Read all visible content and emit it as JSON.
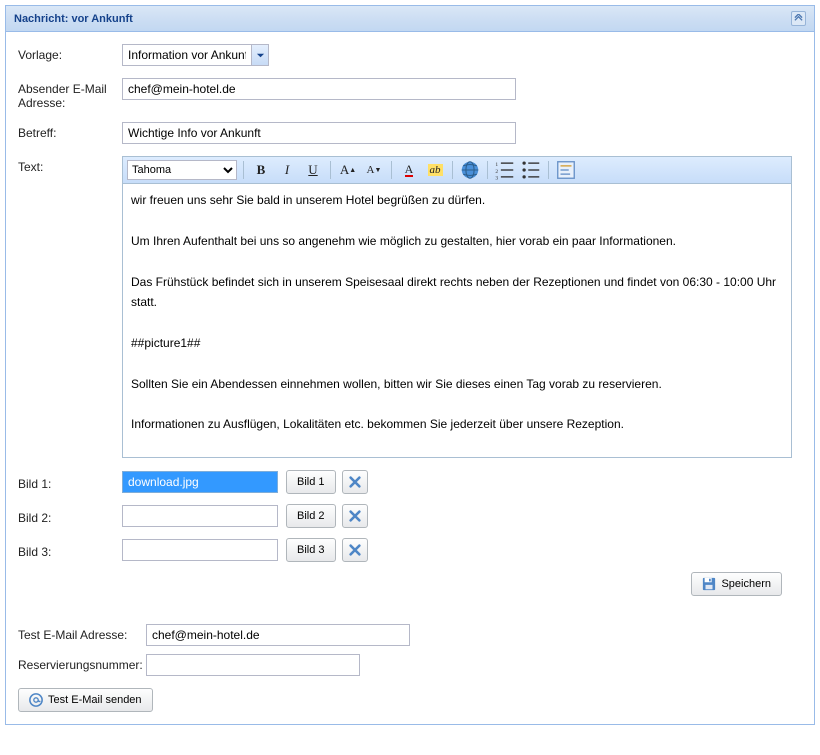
{
  "header": {
    "title": "Nachricht: vor Ankunft"
  },
  "labels": {
    "vorlage": "Vorlage:",
    "absender": "Absender E-Mail Adresse:",
    "betreff": "Betreff:",
    "text": "Text:",
    "bild1": "Bild 1:",
    "bild2": "Bild 2:",
    "bild3": "Bild 3:",
    "testEmail": "Test E-Mail Adresse:",
    "resNr": "Reservierungsnummer:"
  },
  "fields": {
    "vorlage": "Information vor Ankunft",
    "absender": "chef@mein-hotel.de",
    "betreff": "Wichtige Info vor Ankunft",
    "bild1": "download.jpg",
    "bild2": "",
    "bild3": "",
    "testEmail": "chef@mein-hotel.de",
    "resNr": ""
  },
  "editor": {
    "font": "Tahoma",
    "content": "wir freuen uns sehr Sie bald in unserem Hotel begrüßen zu dürfen.\n\nUm Ihren Aufenthalt bei uns so angenehm wie möglich zu gestalten, hier vorab ein paar Informationen.\n\nDas Frühstück befindet sich in unserem Speisesaal direkt rechts neben der Rezeptionen und findet von 06:30 - 10:00 Uhr statt.\n\n##picture1##\n\nSollten Sie ein Abendessen einnehmen wollen, bitten wir Sie dieses einen Tag vorab zu reservieren.\n\nInformationen zu Ausflügen, Lokalitäten etc. bekommen Sie jederzeit über unsere Rezeption.\n\nBei weiteren Fragen stehen wir Ihnen selbstverständlich zur Verfügung.\n\nWir wünschen Ihnen einen netten Aufenthalt in unserem Hause.\n\n##note##"
  },
  "buttons": {
    "bild1": "Bild 1",
    "bild2": "Bild 2",
    "bild3": "Bild 3",
    "speichern": "Speichern",
    "testSenden": "Test E-Mail senden"
  },
  "toolbar": {
    "bold": "B",
    "italic": "I",
    "underline": "U",
    "fontBig": "A",
    "fontSmall": "A"
  }
}
